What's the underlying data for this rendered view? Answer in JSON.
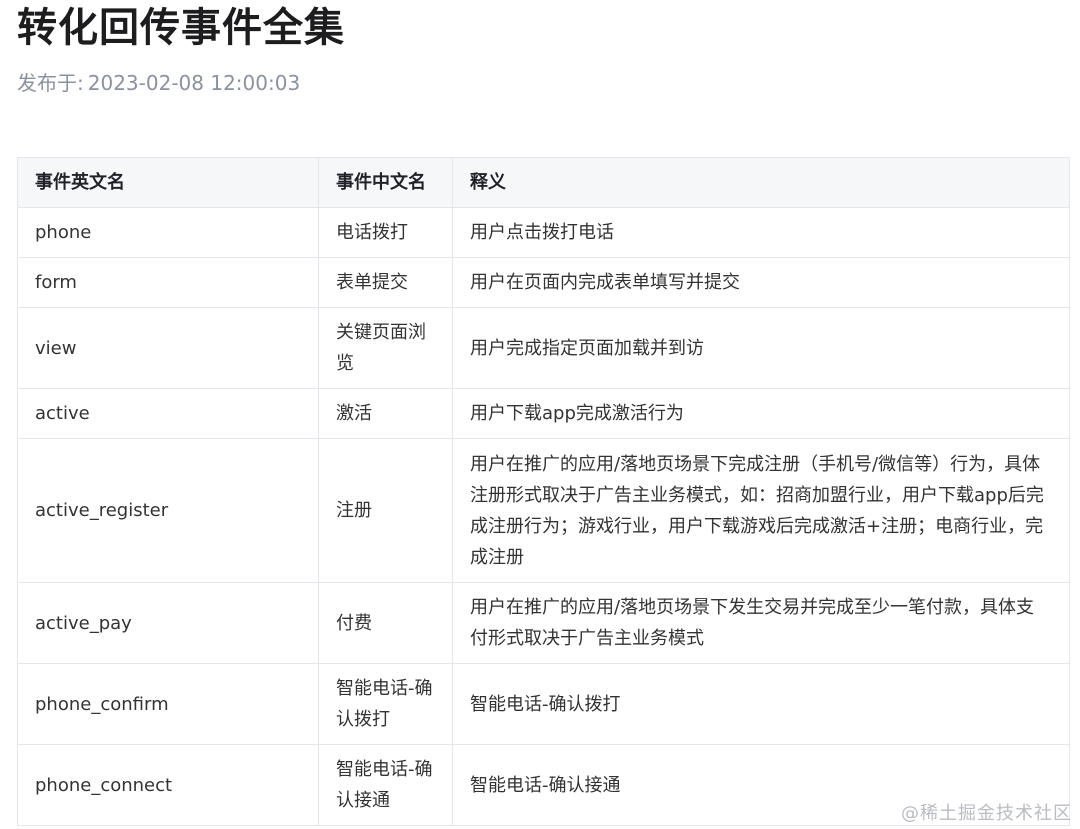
{
  "article": {
    "title": "转化回传事件全集",
    "meta_label": "发布于:",
    "published_at": "2023-02-08 12:00:03"
  },
  "table": {
    "headers": [
      "事件英文名",
      "事件中文名",
      "释义"
    ],
    "rows": [
      {
        "en": "phone",
        "zh": "电话拨打",
        "desc": "用户点击拨打电话"
      },
      {
        "en": "form",
        "zh": "表单提交",
        "desc": "用户在页面内完成表单填写并提交"
      },
      {
        "en": "view",
        "zh": "关键页面浏览",
        "desc": "用户完成指定页面加载并到访"
      },
      {
        "en": "active",
        "zh": "激活",
        "desc": "用户下载app完成激活行为"
      },
      {
        "en": "active_register",
        "zh": "注册",
        "desc": "用户在推广的应用/落地页场景下完成注册（手机号/微信等）行为，具体注册形式取决于广告主业务模式，如：招商加盟行业，用户下载app后完成注册行为；游戏行业，用户下载游戏后完成激活+注册；电商行业，完成注册"
      },
      {
        "en": "active_pay",
        "zh": "付费",
        "desc": "用户在推广的应用/落地页场景下发生交易并完成至少一笔付款，具体支付形式取决于广告主业务模式"
      },
      {
        "en": "phone_confirm",
        "zh": "智能电话-确认拨打",
        "desc": "智能电话-确认拨打"
      },
      {
        "en": "phone_connect",
        "zh": "智能电话-确认接通",
        "desc": "智能电话-确认接通"
      }
    ]
  },
  "watermark": "@稀土掘金技术社区"
}
